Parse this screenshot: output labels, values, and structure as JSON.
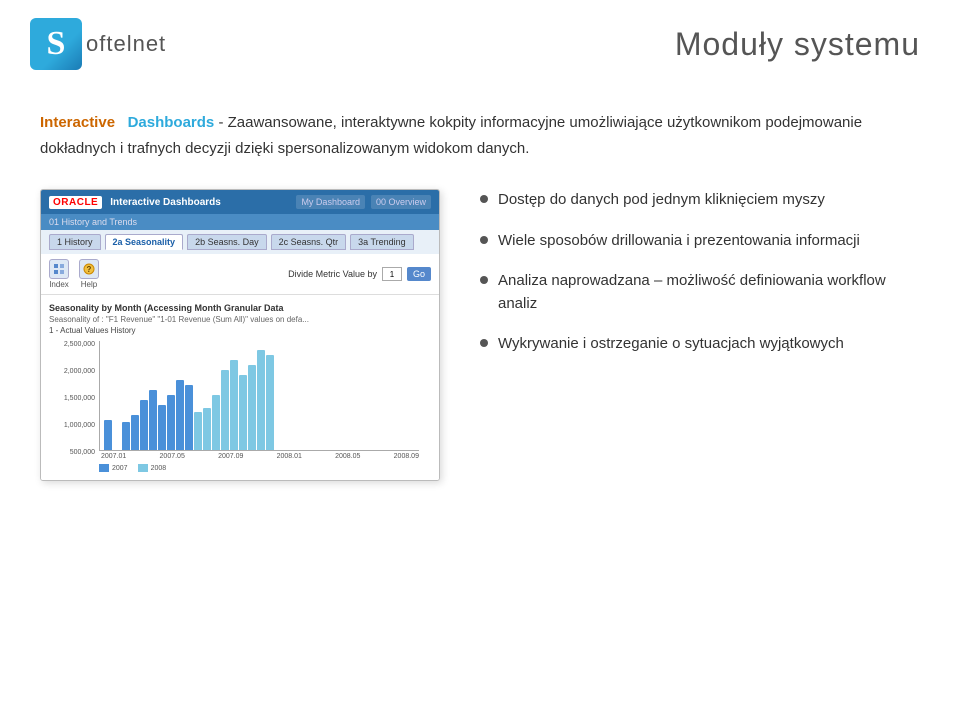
{
  "header": {
    "logo_s": "S",
    "logo_rest": "oftelnet",
    "title": "Moduły systemu"
  },
  "intro": {
    "keyword_interactive": "Interactive",
    "keyword_dashboards": "Dashboards",
    "separator": " - ",
    "description": "Zaawansowane, interaktywne kokpity informacyjne umożliwiające użytkownikom podejmowanie dokładnych i trafnych decyzji dzięki spersonalizowanym widokom danych."
  },
  "dashboard_preview": {
    "oracle_label": "ORACLE",
    "title_bar": "Interactive Dashboards",
    "nav_items": [
      "My Dashboard",
      "00 Overview"
    ],
    "sub_bar": "01 History and Trends",
    "tabs": [
      "1 History",
      "2a Seasonality",
      "2b Seasns. Day",
      "2c Seasns. Qtr",
      "3a Trending"
    ],
    "active_tab": "2a Seasonality",
    "icon1_label": "Index",
    "icon2_label": "Help",
    "divide_label": "Divide Metric Value by",
    "input_value": "1",
    "go_label": "Go",
    "chart_title": "Seasonality by Month (Accessing Month Granular Data",
    "chart_subtitle": "Seasonality of : \"F1 Revenue\" \"1-01 Revenue (Sum All)\" values on defa...",
    "chart_legend": "1 - Actual Values History",
    "y_labels": [
      "2,500,000",
      "2,000,000",
      "1,500,000",
      "1,000,000",
      "500,000"
    ],
    "x_labels": [
      "2007.01",
      "2007.05",
      "2007.09",
      "2008.01",
      "2008.05",
      "2008.09"
    ]
  },
  "bullet_points": [
    {
      "id": 1,
      "text": "Dostęp do danych pod jednym  kliknięciem myszy"
    },
    {
      "id": 2,
      "text": "Wiele sposobów drillowania i prezentowania informacji"
    },
    {
      "id": 3,
      "text": "Analiza naprowadzana – możliwość definiowania workflow analiz"
    },
    {
      "id": 4,
      "text": "Wykrywanie i ostrzeganie o sytuacjach wyjątkowych"
    }
  ],
  "colors": {
    "interactive_color": "#cc6600",
    "dashboards_color": "#2eaadc",
    "logo_blue": "#2eaadc",
    "bar_blue": "#4a90d9",
    "bar_light": "#7ec8e3"
  }
}
